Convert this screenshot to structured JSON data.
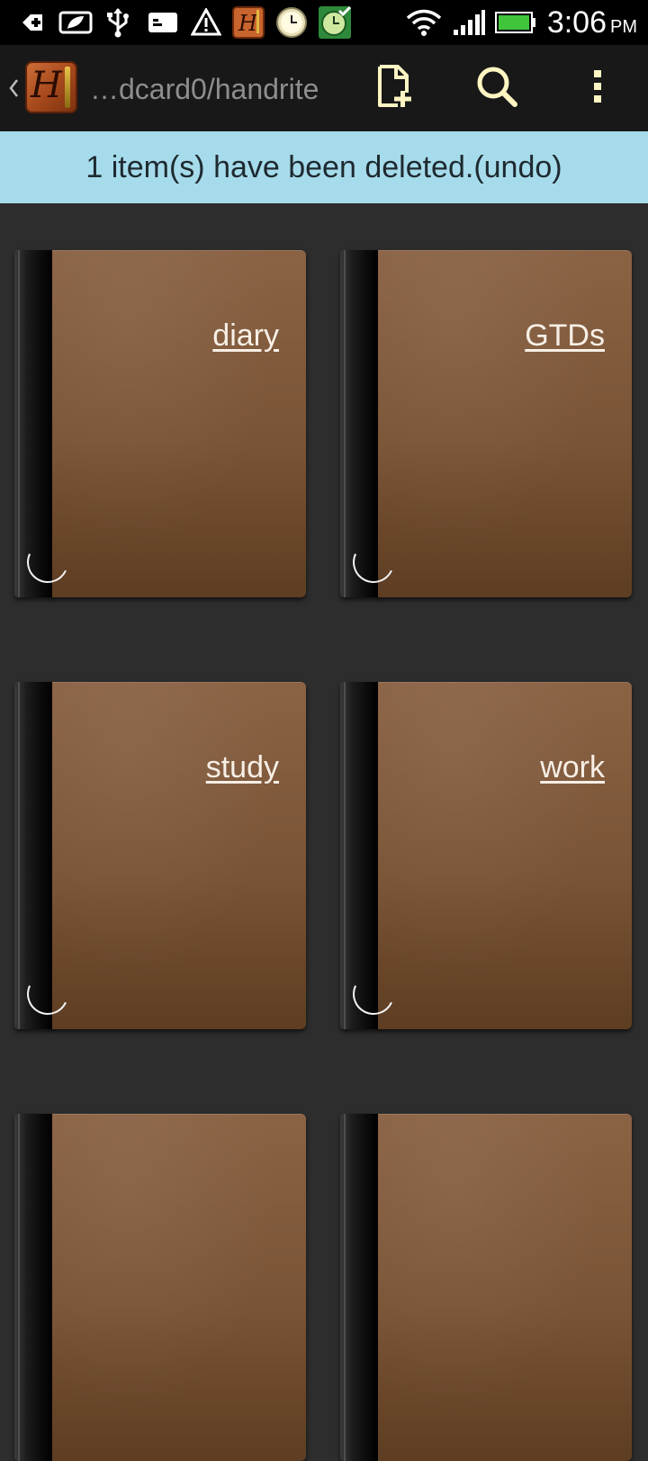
{
  "status_bar": {
    "time": "3:06",
    "ampm": "PM",
    "icons": [
      "plus-icon",
      "evernote-icon",
      "usb-icon",
      "message-icon",
      "warning-icon",
      "handrite-icon",
      "clock-icon",
      "clock-check-icon",
      "wifi-icon",
      "signal-icon",
      "battery-icon"
    ]
  },
  "action_bar": {
    "path_title": "…dcard0/handrite",
    "icons": [
      "back-chevron-icon",
      "app-logo",
      "new-document-icon",
      "search-icon",
      "overflow-menu-icon"
    ]
  },
  "notice": {
    "text": "1 item(s) have been deleted.(undo)"
  },
  "notebooks": [
    {
      "label": "diary"
    },
    {
      "label": "GTDs"
    },
    {
      "label": "study"
    },
    {
      "label": "work"
    }
  ],
  "colors": {
    "background": "#2d2d2d",
    "action_bar": "#181818",
    "notice_bg": "#a6dbeb",
    "cover": "#7a5436",
    "icon_yellow": "#fff5c2"
  }
}
